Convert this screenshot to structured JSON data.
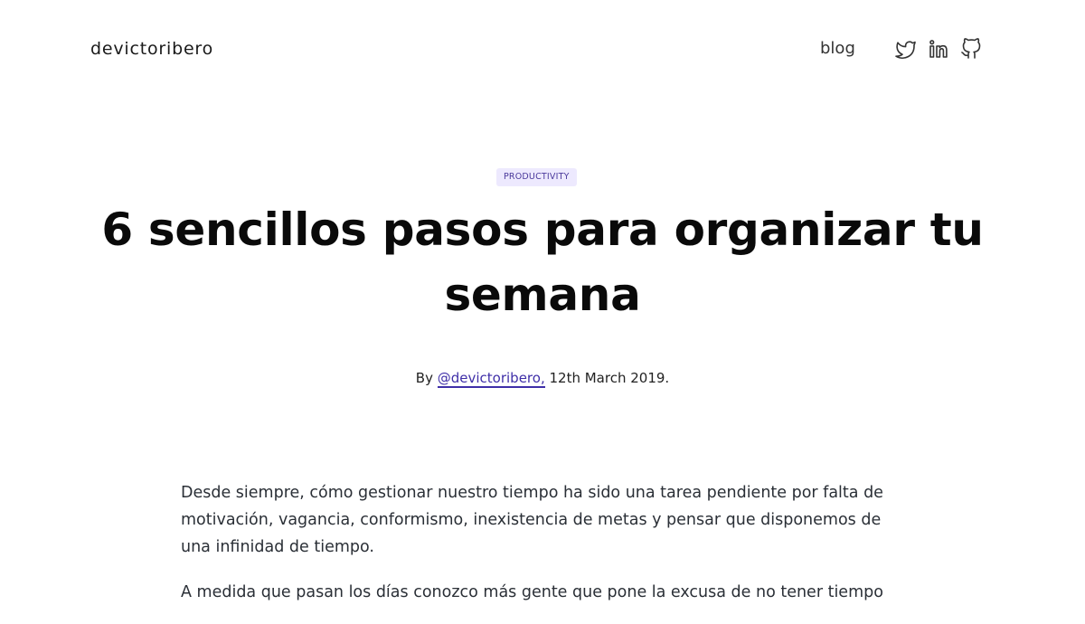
{
  "header": {
    "brand": "devictoribero",
    "nav": {
      "blog": "blog"
    },
    "social": [
      "twitter-icon",
      "linkedin-icon",
      "github-icon"
    ]
  },
  "article": {
    "tag": "PRODUCTIVITY",
    "title": "6 sencillos pasos para organizar tu semana",
    "byline": {
      "prefix": "By",
      "author": "@devictoribero,",
      "date": "12th March 2019."
    },
    "paragraphs": [
      "Desde siempre, cómo gestionar nuestro tiempo ha sido una tarea pendiente por falta de motivación, vagancia, conformismo, inexistencia de metas y pensar que disponemos de una infinidad de tiempo.",
      "A medida que pasan los días conozco más gente que pone la excusa de no tener tiempo"
    ]
  },
  "colors": {
    "accent": "#3f2fa8",
    "tag_bg": "#ede9fe",
    "text": "#2a2f36"
  }
}
